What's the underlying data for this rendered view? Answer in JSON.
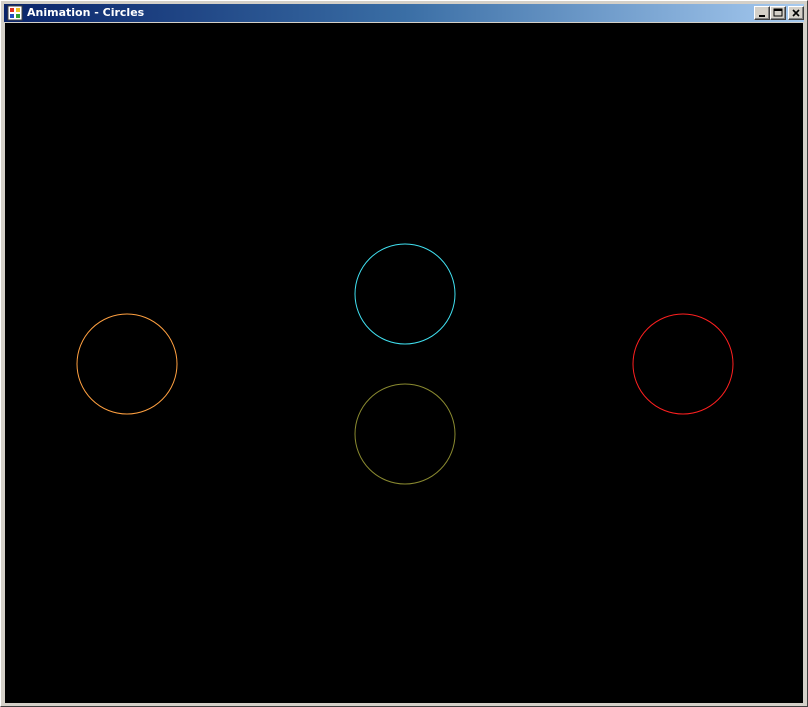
{
  "window": {
    "title": "Animation - Circles",
    "icon": "app-icon",
    "controls": {
      "minimize_icon": "minimize-icon",
      "maximize_icon": "maximize-icon",
      "close_icon": "close-icon"
    }
  },
  "canvas": {
    "background": "#000000",
    "circles": [
      {
        "name": "orange-circle",
        "color": "#ffa040"
      },
      {
        "name": "cyan-circle",
        "color": "#40e0f0"
      },
      {
        "name": "olive-circle",
        "color": "#8a8a30"
      },
      {
        "name": "red-circle",
        "color": "#ff2020"
      }
    ]
  }
}
